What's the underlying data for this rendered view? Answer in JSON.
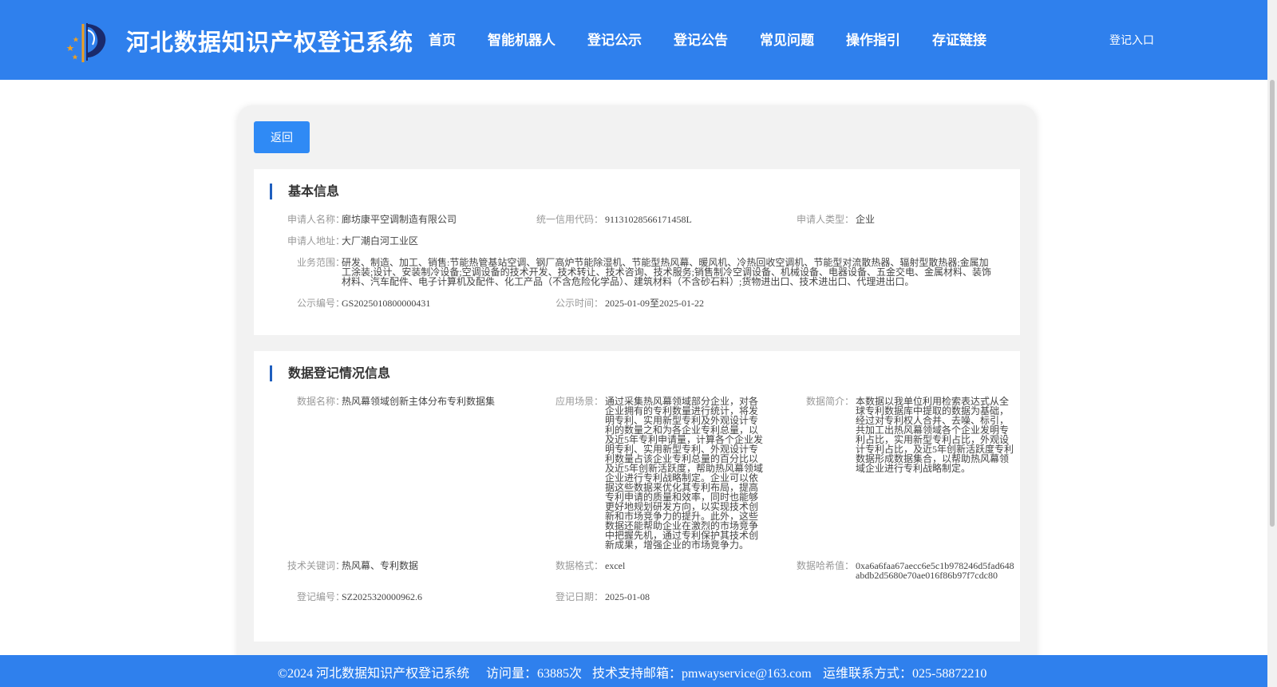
{
  "header": {
    "site_title": "河北数据知识产权登记系统",
    "nav": [
      "首页",
      "智能机器人",
      "登记公示",
      "登记公告",
      "常见问题",
      "操作指引",
      "存证链接"
    ],
    "login_label": "登记入口"
  },
  "back_button_label": "返回",
  "basic_info": {
    "title": "基本信息",
    "applicant_name_label": "申请人名称：",
    "applicant_name": "廊坊康平空调制造有限公司",
    "credit_code_label": "统一信用代码：",
    "credit_code": "91131028566171458L",
    "applicant_type_label": "申请人类型：",
    "applicant_type": "企业",
    "address_label": "申请人地址：",
    "address": "大厂潮白河工业区",
    "business_scope_label": "业务范围：",
    "business_scope": "研发、制造、加工、销售:节能热管基站空调、钢厂高炉节能除湿机、节能型热风幕、暖风机、冷热回收空调机、节能型对流散热器、辐射型散热器;金属加工涂装;设计、安装制冷设备;空调设备的技术开发、技术转让、技术咨询、技术服务;销售制冷空调设备、机械设备、电器设备、五金交电、金属材料、装饰材料、汽车配件、电子计算机及配件、化工产品（不含危险化学品）、建筑材料（不含砂石料）;货物进出口、技术进出口、代理进出口。",
    "publicity_no_label": "公示编号：",
    "publicity_no": "GS2025010800000431",
    "publicity_time_label": "公示时间：",
    "publicity_time": "2025-01-09至2025-01-22"
  },
  "registration_info": {
    "title": "数据登记情况信息",
    "data_name_label": "数据名称：",
    "data_name": "热风幕领域创新主体分布专利数据集",
    "scenario_label": "应用场景：",
    "scenario": "通过采集热风幕领域部分企业，对各企业拥有的专利数量进行统计，将发明专利、实用新型专利及外观设计专利的数量之和为各企业专利总量，以及近5年专利申请量，计算各个企业发明专利、实用新型专利、外观设计专利数量占该企业专利总量的百分比以及近5年创新活跃度，帮助热风幕领域企业进行专利战略制定。企业可以依据这些数据来优化其专利布局，提高专利申请的质量和效率，同时也能够更好地规划研发方向，以实现技术创新和市场竞争力的提升。此外，这些数据还能帮助企业在激烈的市场竞争中把握先机，通过专利保护其技术创新成果，增强企业的市场竞争力。",
    "summary_label": "数据简介：",
    "summary": "本数据以我单位利用检索表达式从全球专利数据库中提取的数据为基础，经过对专利权人合并、去噪、标引，共加工出热风幕领域各个企业发明专利占比，实用新型专利占比，外观设计专利占比，及近5年创新活跃度专利数据形成数据集合，以帮助热风幕领域企业进行专利战略制定。",
    "keywords_label": "技术关键词：",
    "keywords": "热风幕、专利数据",
    "format_label": "数据格式：",
    "format": "excel",
    "hash_label": "数据哈希值：",
    "hash": "0xa6a6faa67aecc6e5c1b978246d5fad648abdb2d5680e70ae016f86b97f7cdc80",
    "reg_no_label": "登记编号：",
    "reg_no": "SZ2025320000962.6",
    "reg_date_label": "登记日期：",
    "reg_date": "2025-01-08"
  },
  "footer": {
    "copyright": "©2024 河北数据知识产权登记系统",
    "visits": "访问量：63885次",
    "support_email": "技术支持邮箱：pmwayservice@163.com",
    "ops_contact": "运维联系方式：025-58872210"
  },
  "colors": {
    "primary": "#2f80ed",
    "button": "#2f8af5",
    "section_bar": "#1f5fbf",
    "panel_bg": "#f2f2f2"
  }
}
